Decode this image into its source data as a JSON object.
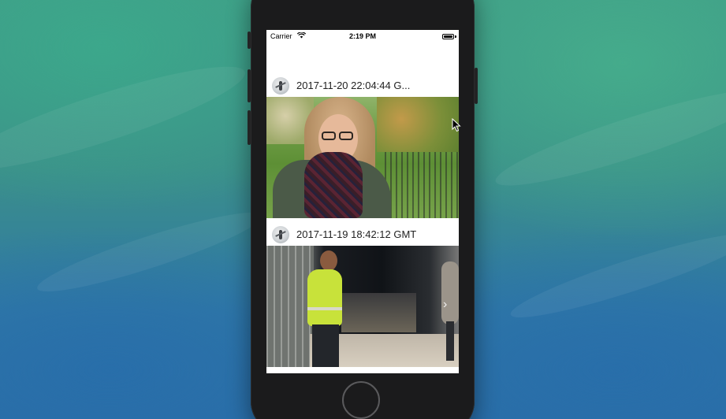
{
  "status_bar": {
    "carrier": "Carrier",
    "time": "2:19 PM",
    "battery_level": 1.0
  },
  "feed": {
    "posts": [
      {
        "title": "2017-11-20 22:04:44 G...",
        "avatar_icon": "avatar-icon",
        "photo_icon": "photo-woman-park"
      },
      {
        "title": "2017-11-19 18:42:12 GMT",
        "avatar_icon": "avatar-icon",
        "photo_icon": "photo-man-bridge"
      }
    ]
  },
  "colors": {
    "screen_background": "#ffffff",
    "phone_body": "#1b1b1c",
    "text": "#222222"
  }
}
